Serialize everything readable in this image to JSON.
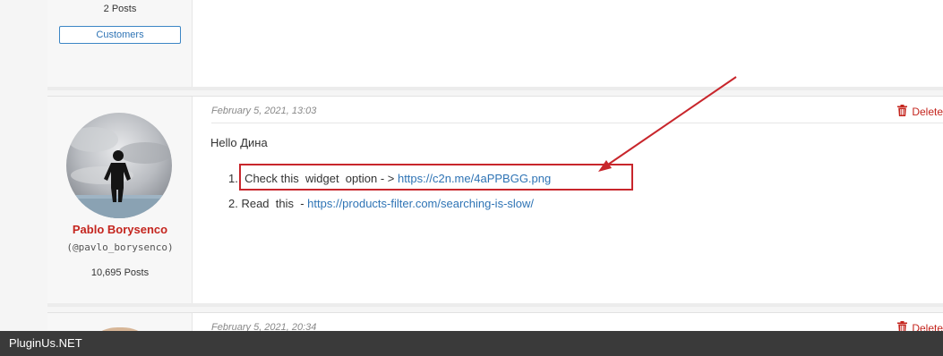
{
  "replies": [
    {
      "post_count": "2 Posts",
      "role": "Customers"
    },
    {
      "date": "February 5, 2021, 13:03",
      "delete_label": "Delete",
      "author": {
        "name": "Pablo Borysenco",
        "handle": "(@pavlo_borysenco)",
        "post_count": "10,695 Posts"
      },
      "greeting": "Hello Дина",
      "items": [
        {
          "prefix": "1.  Check this  widget  option - > ",
          "link": "https://c2n.me/4aPPBGG.png"
        },
        {
          "prefix": "2. Read  this  - ",
          "link": "https://products-filter.com/searching-is-slow/"
        }
      ]
    },
    {
      "date": "February 5, 2021, 20:34",
      "delete_label": "Delete"
    }
  ],
  "footer": {
    "brand": "PluginUs.NET"
  },
  "colors": {
    "accent_red": "#c4251e",
    "link_blue": "#2f74b5",
    "annotation_red": "#c8262c"
  },
  "icons": {
    "delete": "trash-icon"
  }
}
